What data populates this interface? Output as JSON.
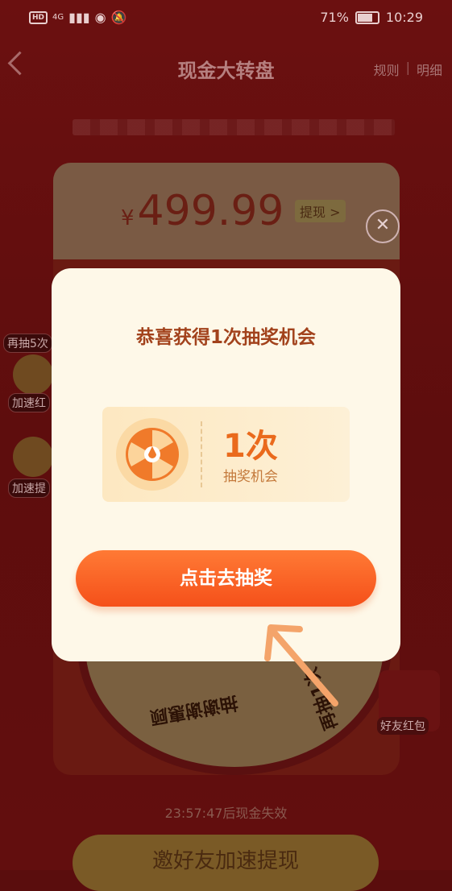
{
  "status_bar": {
    "hd": "HD",
    "network": "4G",
    "battery": "71%",
    "time": "10:29"
  },
  "header": {
    "title": "现金大转盘",
    "rules": "规则",
    "detail": "明细",
    "separator": "|"
  },
  "background": {
    "amount_currency": "¥",
    "amount": "499.99",
    "withdraw_label": "提现 >",
    "side_tag_draw5": "再抽5次",
    "side_tag_speed1": "加速红",
    "side_tag_speed2": "加速提",
    "wheel_text_left": "抽谢谢惠顾",
    "wheel_text_right": "再抽1次",
    "friend_redpacket": "好友红包",
    "countdown": "23:57:47后现金失效",
    "invite_button": "邀好友加速提现"
  },
  "close_icon_glyph": "✕",
  "modal": {
    "title": "恭喜获得1次抽奖机会",
    "chance_count": "1次",
    "chance_label": "抽奖机会",
    "cta_label": "点击去抽奖"
  },
  "colors": {
    "cta": "#f5501a",
    "modal_bg": "#fef8e8",
    "title": "#a2421c",
    "count": "#ea6a1c"
  }
}
